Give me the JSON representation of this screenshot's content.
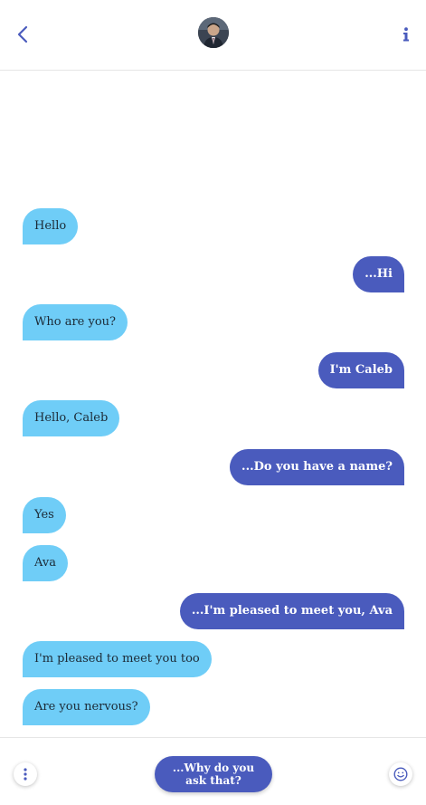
{
  "header": {
    "back_icon": "chevron-left-icon",
    "avatar_icon": "avatar",
    "info_icon": "info-icon"
  },
  "messages": [
    {
      "from": "them",
      "text": "Hello"
    },
    {
      "from": "me",
      "text": "...Hi"
    },
    {
      "from": "them",
      "text": "Who are you?"
    },
    {
      "from": "me",
      "text": "I'm Caleb"
    },
    {
      "from": "them",
      "text": "Hello, Caleb"
    },
    {
      "from": "me",
      "text": "...Do you have a name?"
    },
    {
      "from": "them",
      "text": "Yes"
    },
    {
      "from": "them",
      "text": "Ava"
    },
    {
      "from": "me",
      "text": "...I'm pleased to meet you, Ava"
    },
    {
      "from": "them",
      "text": "I'm pleased to meet you too"
    },
    {
      "from": "them",
      "text": "Are you nervous?"
    }
  ],
  "footer": {
    "more_icon": "more-vertical-icon",
    "reply_label": "...Why do you ask that?",
    "emoji_icon": "smiley-icon"
  },
  "colors": {
    "accent": "#4a5bbd",
    "incoming_bubble": "#6fcdf7",
    "incoming_text": "#1c2a36",
    "outgoing_text": "#ffffff"
  }
}
